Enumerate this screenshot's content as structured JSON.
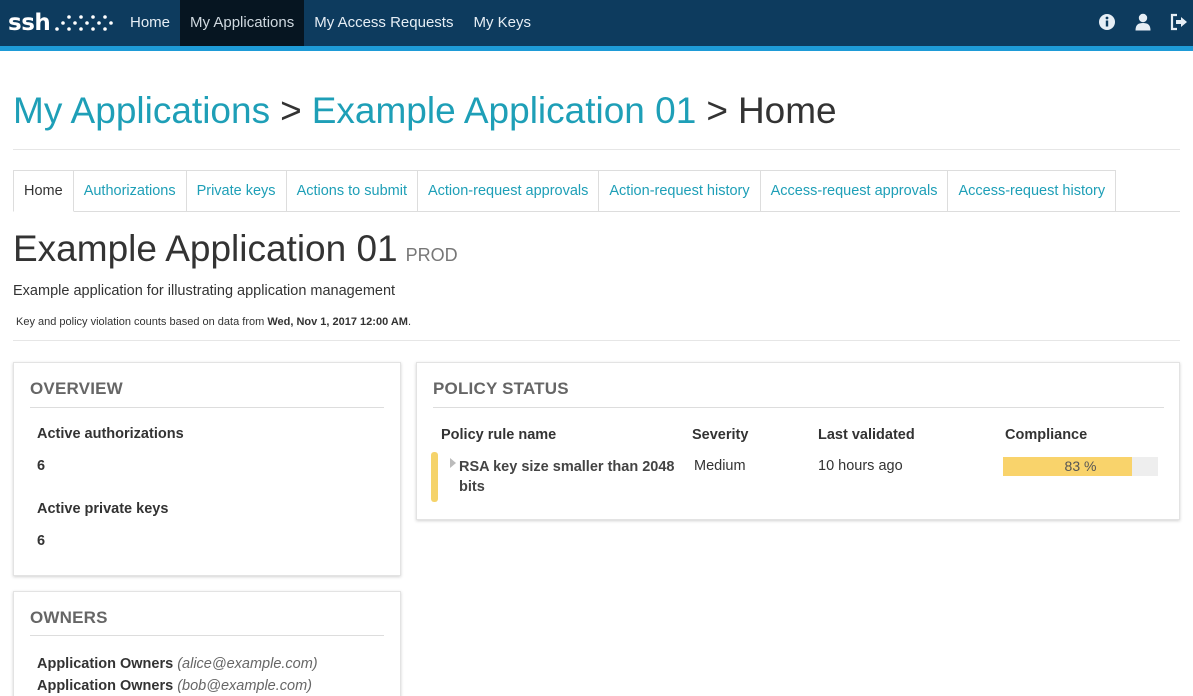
{
  "brand": {
    "logo_text": "ssh"
  },
  "nav": {
    "items": [
      {
        "label": "Home",
        "active": false
      },
      {
        "label": "My Applications",
        "active": true
      },
      {
        "label": "My Access Requests",
        "active": false
      },
      {
        "label": "My Keys",
        "active": false
      }
    ],
    "icons": [
      "info-icon",
      "user-icon",
      "logout-icon"
    ]
  },
  "breadcrumb": {
    "items": [
      "My Applications",
      "Example Application 01",
      "Home"
    ],
    "separator": ">"
  },
  "tabs": [
    {
      "label": "Home",
      "active": true
    },
    {
      "label": "Authorizations",
      "active": false
    },
    {
      "label": "Private keys",
      "active": false
    },
    {
      "label": "Actions to submit",
      "active": false
    },
    {
      "label": "Action-request approvals",
      "active": false
    },
    {
      "label": "Action-request history",
      "active": false
    },
    {
      "label": "Access-request approvals",
      "active": false
    },
    {
      "label": "Access-request history",
      "active": false
    }
  ],
  "app": {
    "title": "Example Application 01",
    "environment": "PROD",
    "description": "Example application for illustrating application management",
    "data_note_prefix": "Key and policy violation counts based on data from",
    "data_note_date": "Wed, Nov 1, 2017 12:00 AM",
    "data_note_suffix": "."
  },
  "overview": {
    "title": "OVERVIEW",
    "items": [
      {
        "label": "Active authorizations",
        "value": "6"
      },
      {
        "label": "Active private keys",
        "value": "6"
      }
    ]
  },
  "owners": {
    "title": "OWNERS",
    "items": [
      {
        "role": "Application Owners",
        "email": "(alice@example.com)"
      },
      {
        "role": "Application Owners",
        "email": "(bob@example.com)"
      }
    ]
  },
  "policy_status": {
    "title": "POLICY STATUS",
    "columns": [
      "Policy rule name",
      "Severity",
      "Last validated",
      "Compliance"
    ],
    "rows": [
      {
        "rule_name": "RSA key size smaller than 2048 bits",
        "severity": "Medium",
        "last_validated": "10 hours ago",
        "compliance_label": "83 %",
        "compliance_fraction": 0.83
      }
    ]
  },
  "colors": {
    "topbar": "#0d3b5e",
    "accent": "#1e9bd7",
    "link": "#1e9fb7",
    "compliance_bar": "#f9d36b"
  }
}
